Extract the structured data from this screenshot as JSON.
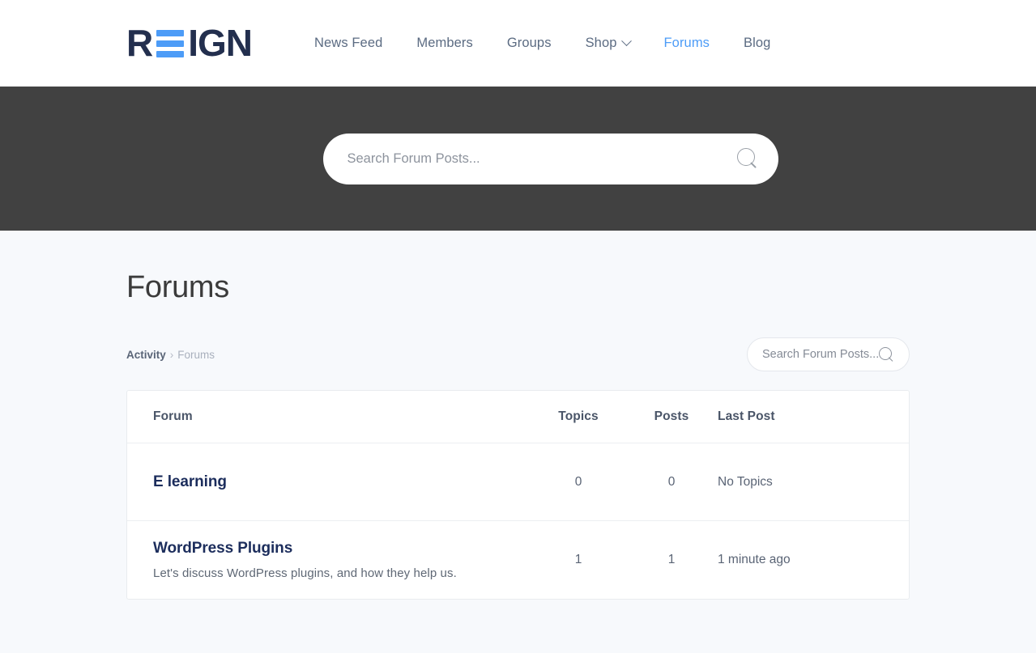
{
  "header": {
    "logo": {
      "part1": "R",
      "icon": "equals-bars-icon",
      "part2": "IGN",
      "alt": "REIGN"
    },
    "nav": [
      {
        "label": "News Feed",
        "active": false,
        "has_dropdown": false
      },
      {
        "label": "Members",
        "active": false,
        "has_dropdown": false
      },
      {
        "label": "Groups",
        "active": false,
        "has_dropdown": false
      },
      {
        "label": "Shop",
        "active": false,
        "has_dropdown": true
      },
      {
        "label": "Forums",
        "active": true,
        "has_dropdown": false
      },
      {
        "label": "Blog",
        "active": false,
        "has_dropdown": false
      }
    ]
  },
  "banner": {
    "search": {
      "placeholder": "Search Forum Posts...",
      "value": "",
      "icon": "search-icon"
    }
  },
  "page": {
    "title": "Forums",
    "breadcrumb": {
      "link": "Activity",
      "separator": "›",
      "current": "Forums"
    },
    "mini_search": {
      "placeholder": "Search Forum Posts...",
      "value": "",
      "icon": "search-icon"
    }
  },
  "table": {
    "columns": {
      "forum": "Forum",
      "topics": "Topics",
      "posts": "Posts",
      "last_post": "Last Post"
    },
    "rows": [
      {
        "name": "E learning",
        "description": "",
        "topics": "0",
        "posts": "0",
        "last_post": "No Topics"
      },
      {
        "name": "WordPress Plugins",
        "description": "Let's discuss WordPress plugins, and how they help us.",
        "topics": "1",
        "posts": "1",
        "last_post": "1 minute ago"
      }
    ]
  },
  "colors": {
    "accent_blue": "#4d9cf7",
    "logo_navy": "#232f4e",
    "banner_dark": "#414141",
    "page_bg": "#f7f9fc",
    "forum_title": "#1c2d5c"
  }
}
